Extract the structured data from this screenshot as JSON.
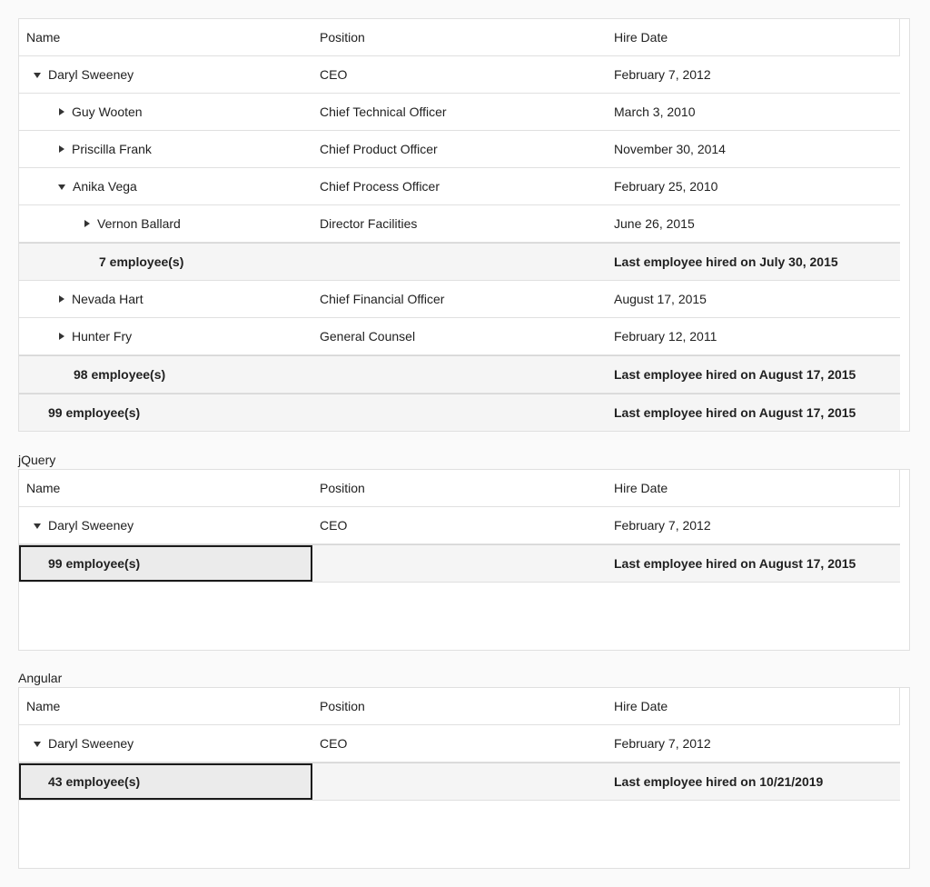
{
  "columns": {
    "name": "Name",
    "position": "Position",
    "hire_date": "Hire Date"
  },
  "grid1": {
    "rows": [
      {
        "name": "Daryl Sweeney",
        "position": "CEO",
        "hire_date": "February 7, 2012"
      },
      {
        "name": "Guy Wooten",
        "position": "Chief Technical Officer",
        "hire_date": "March 3, 2010"
      },
      {
        "name": "Priscilla Frank",
        "position": "Chief Product Officer",
        "hire_date": "November 30, 2014"
      },
      {
        "name": "Anika Vega",
        "position": "Chief Process Officer",
        "hire_date": "February 25, 2010"
      },
      {
        "name": "Vernon Ballard",
        "position": "Director Facilities",
        "hire_date": "June 26, 2015"
      },
      {
        "name": "7 employee(s)",
        "position": "",
        "hire_date": "Last employee hired on July 30, 2015"
      },
      {
        "name": "Nevada Hart",
        "position": "Chief Financial Officer",
        "hire_date": "August 17, 2015"
      },
      {
        "name": "Hunter Fry",
        "position": "General Counsel",
        "hire_date": "February 12, 2011"
      },
      {
        "name": "98 employee(s)",
        "position": "",
        "hire_date": "Last employee hired on August 17, 2015"
      },
      {
        "name": "99 employee(s)",
        "position": "",
        "hire_date": "Last employee hired on August 17, 2015"
      }
    ]
  },
  "grid2": {
    "label": "jQuery",
    "rows": [
      {
        "name": "Daryl Sweeney",
        "position": "CEO",
        "hire_date": "February 7, 2012"
      },
      {
        "name": "99 employee(s)",
        "position": "",
        "hire_date": "Last employee hired on August 17, 2015"
      }
    ]
  },
  "grid3": {
    "label": "Angular",
    "rows": [
      {
        "name": "Daryl Sweeney",
        "position": "CEO",
        "hire_date": "February 7, 2012"
      },
      {
        "name": "43 employee(s)",
        "position": "",
        "hire_date": "Last employee hired on 10/21/2019"
      }
    ]
  }
}
